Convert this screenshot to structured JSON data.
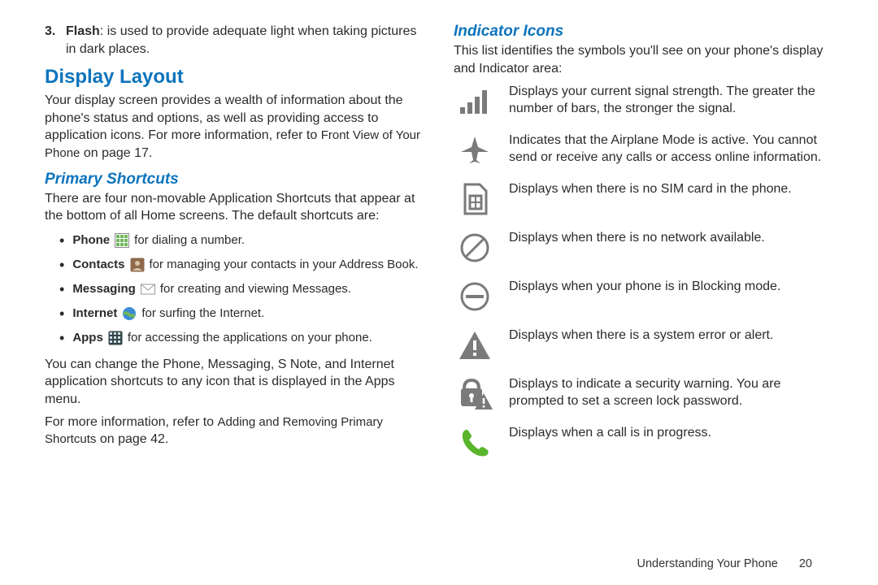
{
  "left": {
    "flash_num": "3.",
    "flash_label": "Flash",
    "flash_text": ": is used to provide adequate light when taking pictures in dark places.",
    "display_layout": "Display Layout",
    "display_para_a": "Your display screen provides a wealth of information about the phone's status and options, as well as providing access to application icons. For more information, refer to ",
    "display_para_ref": "Front View of Your Phone",
    "display_para_b": " on page 17.",
    "primary_shortcuts": "Primary Shortcuts",
    "shortcuts_para": "There are four non-movable Application Shortcuts that appear at the bottom of all Home screens. The default shortcuts are:",
    "items": {
      "phone_b": "Phone",
      "phone_t": " for dialing a number.",
      "contacts_b": "Contacts",
      "contacts_t": " for managing your contacts in your Address Book.",
      "messaging_b": "Messaging",
      "messaging_t": " for creating and viewing Messages.",
      "internet_b": "Internet",
      "internet_t": " for surfing the Internet.",
      "apps_b": "Apps",
      "apps_t": " for accessing the applications on your phone."
    },
    "change_para": "You can change the Phone, Messaging, S Note, and Internet application shortcuts to any icon that is displayed in the Apps menu.",
    "more_a": "For more information, refer to ",
    "more_ref": "Adding and Removing Primary Shortcuts",
    "more_b": " on page 42."
  },
  "right": {
    "indicator_icons": "Indicator Icons",
    "intro": "This list identifies the symbols you'll see on your phone's display and Indicator area:",
    "rows": {
      "signal": "Displays your current signal strength. The greater the number of bars, the stronger the signal.",
      "airplane": "Indicates that the Airplane Mode is active. You cannot send or receive any calls or access online information.",
      "nosim": "Displays when there is no SIM card in the phone.",
      "nonet": "Displays when there is no network available.",
      "blocking": "Displays when your phone is in Blocking mode.",
      "alert": "Displays when there is a system error or alert.",
      "seclock": "Displays to indicate a security warning. You are prompted to set a screen lock password.",
      "call": "Displays when a call is in progress."
    }
  },
  "footer": {
    "section": "Understanding Your Phone",
    "page": "20"
  }
}
